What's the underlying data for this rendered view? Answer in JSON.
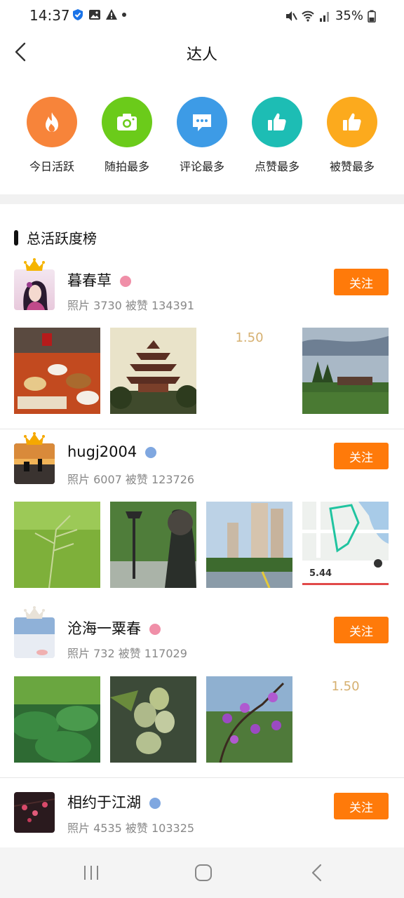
{
  "status_bar": {
    "time": "14:37",
    "battery": "35%"
  },
  "header": {
    "title": "达人"
  },
  "categories": [
    {
      "label": "今日活跃",
      "icon": "flame-icon",
      "color": "#f7843a"
    },
    {
      "label": "随拍最多",
      "icon": "camera-icon",
      "color": "#6bcb1a"
    },
    {
      "label": "评论最多",
      "icon": "comment-icon",
      "color": "#3d9be6"
    },
    {
      "label": "点赞最多",
      "icon": "thumbs-up-icon",
      "color": "#1dbdb4"
    },
    {
      "label": "被赞最多",
      "icon": "thumbs-up-icon",
      "color": "#fcaa1d"
    }
  ],
  "section": {
    "title": "总活跃度榜"
  },
  "users": [
    {
      "name": "暮春草",
      "stats": "照片 3730  被赞 134391",
      "follow_label": "关注",
      "badge_color": "#f08fa8",
      "crown_color": "#f5b400"
    },
    {
      "name": "hugj2004",
      "stats": "照片 6007  被赞 123726",
      "follow_label": "关注",
      "badge_color": "#7fa7e0",
      "crown_color": "#f5a800"
    },
    {
      "name": "沧海一粟春",
      "stats": "照片 732  被赞 117029",
      "follow_label": "关注",
      "badge_color": "#f08fa8",
      "crown_color": "#e8e2d8"
    },
    {
      "name": "相约于江湖",
      "stats": "照片 4535  被赞 103325",
      "follow_label": "关注",
      "badge_color": "#7fa7e0",
      "crown_color": ""
    }
  ],
  "photo_texts": {
    "distance_1": "1.50",
    "map_distance": "5.44",
    "distance_3": "1.50"
  },
  "accent_color": "#ff7a0a"
}
